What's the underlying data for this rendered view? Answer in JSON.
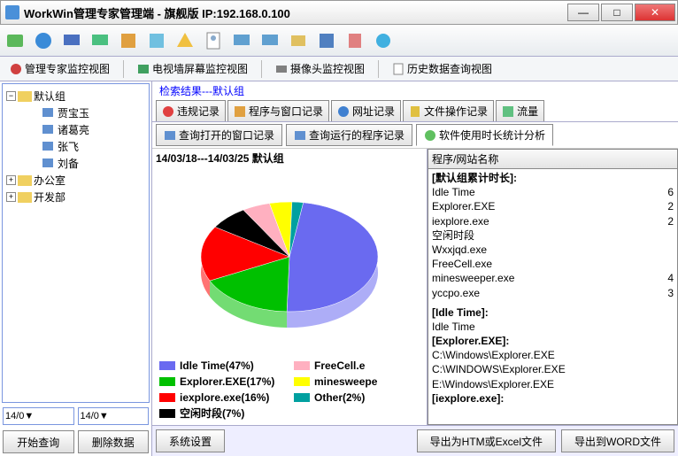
{
  "window": {
    "title": "WorkWin管理专家管理端 - 旗舰版 IP:192.168.0.100"
  },
  "viewtabs": {
    "v1": "管理专家监控视图",
    "v2": "电视墙屏幕监控视图",
    "v3": "摄像头监控视图",
    "v4": "历史数据查询视图"
  },
  "tree": {
    "root": "默认组",
    "u1": "贾宝玉",
    "u2": "诸葛亮",
    "u3": "张飞",
    "u4": "刘备",
    "g2": "办公室",
    "g3": "开发部"
  },
  "dates": {
    "from": "14/0▼",
    "to": "14/0▼"
  },
  "sidebtns": {
    "query": "开始查询",
    "delete": "删除数据"
  },
  "search_result": "检索结果---默认组",
  "rectabs": {
    "t1": "违规记录",
    "t2": "程序与窗口记录",
    "t3": "网址记录",
    "t4": "文件操作记录",
    "t5": "流量"
  },
  "subtabs": {
    "s1": "查询打开的窗口记录",
    "s2": "查询运行的程序记录",
    "s3": "软件使用时长统计分析"
  },
  "chart_header": "14/03/18---14/03/25    默认组",
  "list_header": "程序/网站名称",
  "groups": {
    "g1": "[默认组累计时长]:",
    "g2": "[Idle Time]:",
    "g3": "[Explorer.EXE]:",
    "g4": "[iexplore.exe]:"
  },
  "rows": {
    "r1": {
      "n": "Idle Time",
      "v": "6"
    },
    "r2": {
      "n": "Explorer.EXE",
      "v": "2"
    },
    "r3": {
      "n": "iexplore.exe",
      "v": "2"
    },
    "r4": {
      "n": "空闲时段",
      "v": ""
    },
    "r5": {
      "n": "Wxxjqd.exe",
      "v": ""
    },
    "r6": {
      "n": "FreeCell.exe",
      "v": ""
    },
    "r7": {
      "n": "minesweeper.exe",
      "v": "4"
    },
    "r8": {
      "n": "yccpo.exe",
      "v": "3"
    },
    "r9": {
      "n": "Idle Time",
      "v": ""
    },
    "r10": {
      "n": "C:\\Windows\\Explorer.EXE",
      "v": ""
    },
    "r11": {
      "n": "C:\\WINDOWS\\Explorer.EXE",
      "v": ""
    },
    "r12": {
      "n": "E:\\Windows\\Explorer.EXE",
      "v": ""
    }
  },
  "bottom": {
    "b1": "系统设置",
    "b2": "导出为HTM或Excel文件",
    "b3": "导出到WORD文件"
  },
  "chart_data": {
    "type": "pie",
    "title": "14/03/18---14/03/25 默认组",
    "series": [
      {
        "name": "Idle Time",
        "value": 47,
        "color": "#6a6af0"
      },
      {
        "name": "Explorer.EXE",
        "value": 17,
        "color": "#00c000"
      },
      {
        "name": "iexplore.exe",
        "value": 16,
        "color": "#ff0000"
      },
      {
        "name": "空闲时段",
        "value": 7,
        "color": "#000000"
      },
      {
        "name": "FreeCell.exe",
        "value": 5,
        "color": "#ffb0c0"
      },
      {
        "name": "minesweeper.exe",
        "value": 4,
        "color": "#ffff00"
      },
      {
        "name": "Other",
        "value": 2,
        "color": "#00a0a0"
      }
    ],
    "legend_left": [
      "Idle Time(47%)",
      "Explorer.EXE(17%)",
      "iexplore.exe(16%)",
      "空闲时段(7%)"
    ],
    "legend_right": [
      "FreeCell.e",
      "minesweepe",
      "Other(2%)"
    ]
  }
}
